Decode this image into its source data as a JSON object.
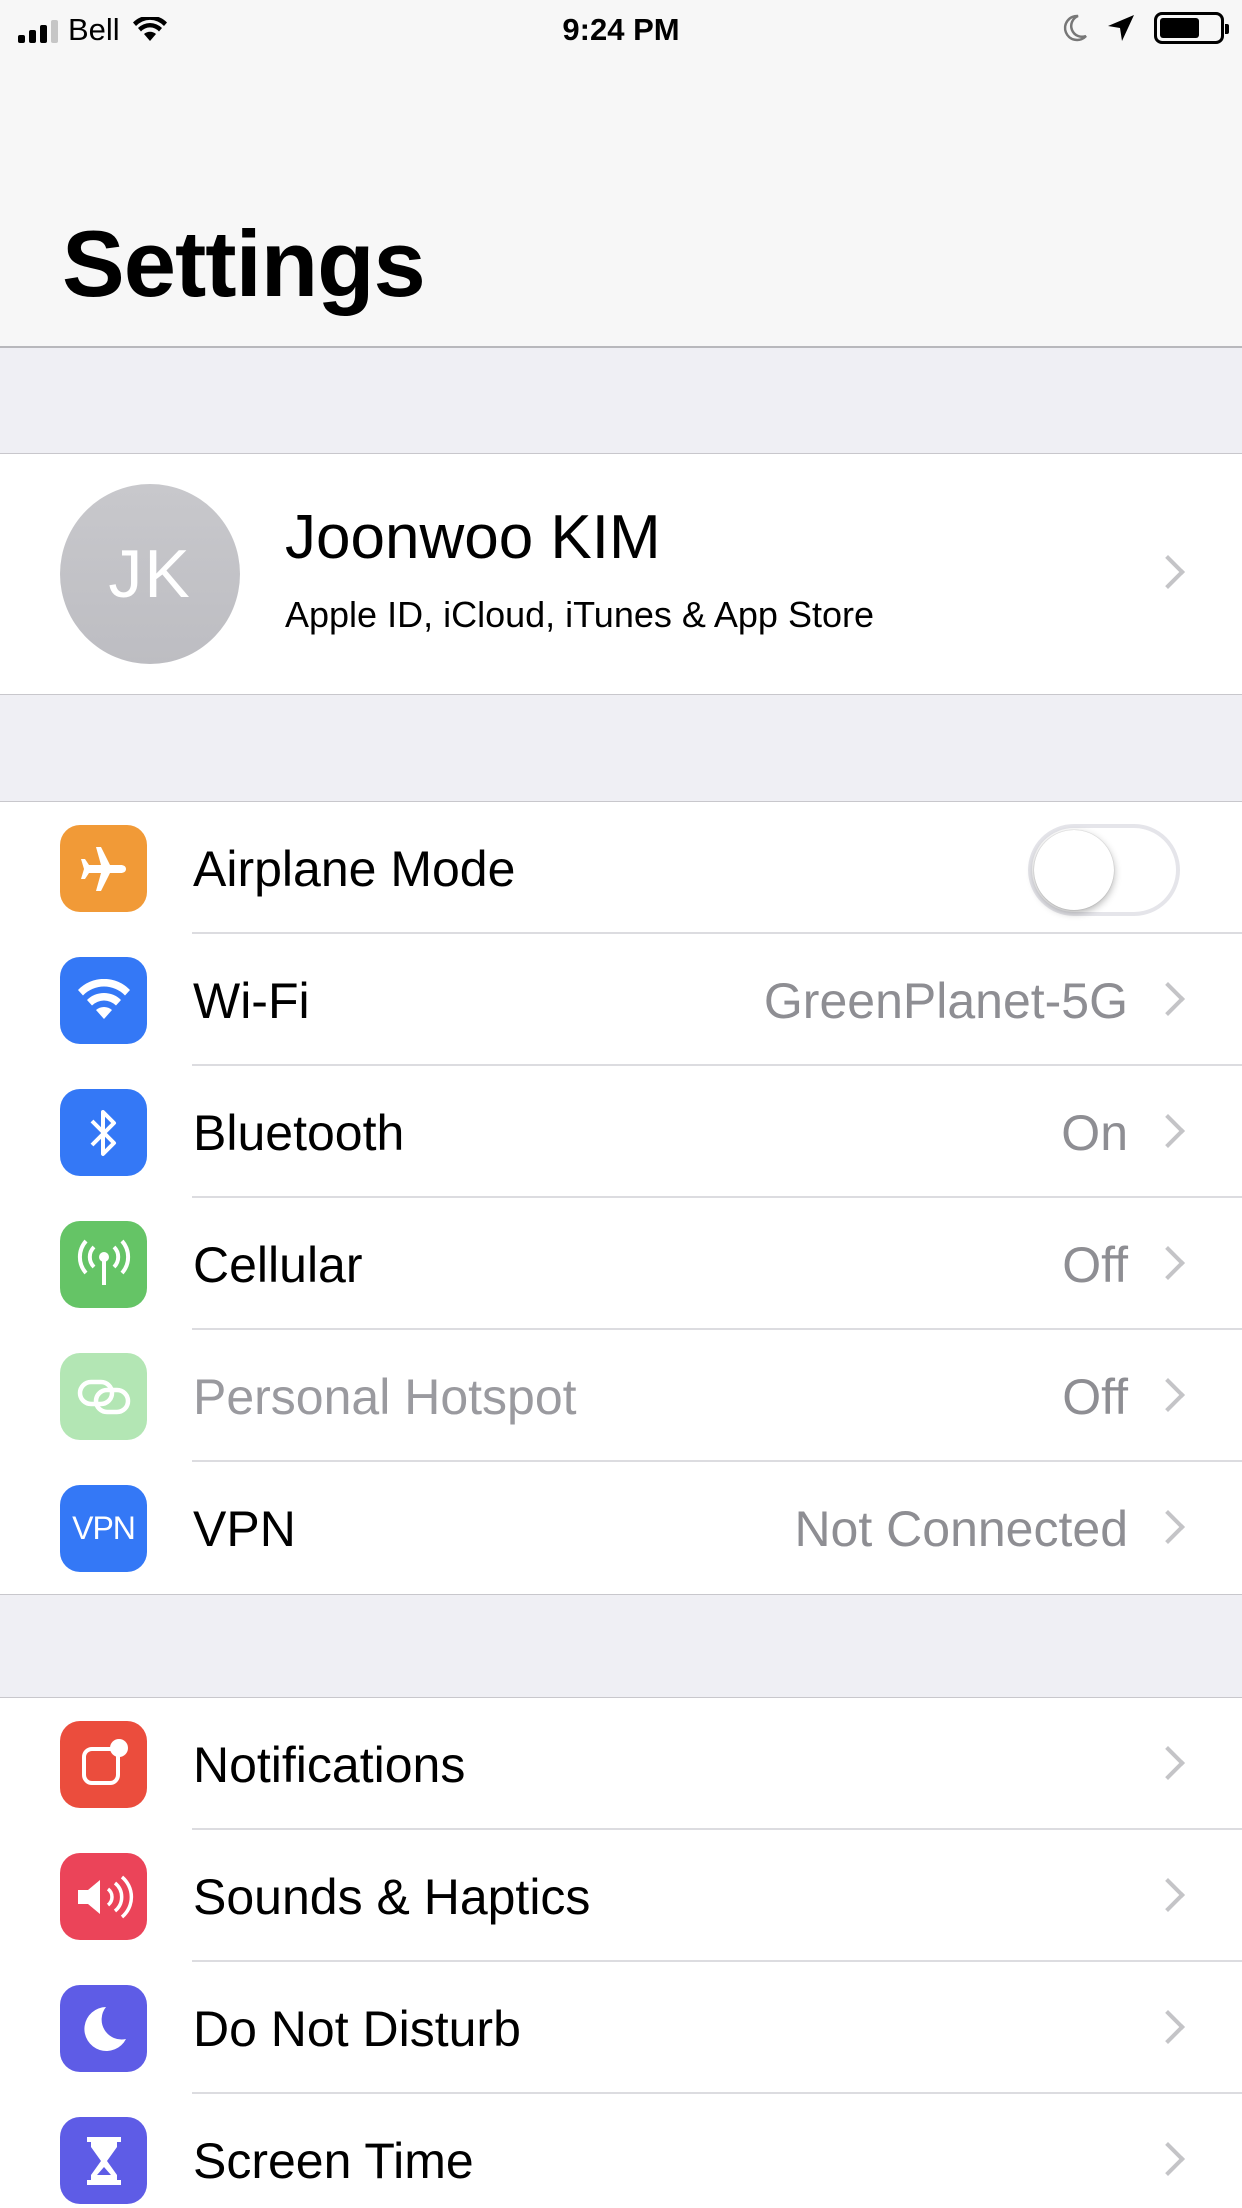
{
  "status_bar": {
    "carrier": "Bell",
    "time": "9:24 PM",
    "battery_level": 0.68
  },
  "header": {
    "title": "Settings"
  },
  "profile": {
    "initials": "JK",
    "name": "Joonwoo KIM",
    "subtitle": "Apple ID, iCloud, iTunes & App Store"
  },
  "connectivity": [
    {
      "label": "Airplane Mode",
      "icon": "airplane-icon",
      "color": "#f19a37",
      "toggle": false
    },
    {
      "label": "Wi-Fi",
      "icon": "wifi-icon",
      "color": "#3478f6",
      "value": "GreenPlanet-5G"
    },
    {
      "label": "Bluetooth",
      "icon": "bluetooth-icon",
      "color": "#3478f6",
      "value": "On"
    },
    {
      "label": "Cellular",
      "icon": "cellular-antenna-icon",
      "color": "#65c466",
      "value": "Off"
    },
    {
      "label": "Personal Hotspot",
      "icon": "hotspot-icon",
      "color": "#b3e6b4",
      "value": "Off",
      "disabled": true
    },
    {
      "label": "VPN",
      "icon": "vpn-icon",
      "icon_text": "VPN",
      "color": "#3478f6",
      "value": "Not Connected"
    }
  ],
  "system": [
    {
      "label": "Notifications",
      "icon": "notifications-icon",
      "color": "#eb4d3d"
    },
    {
      "label": "Sounds & Haptics",
      "icon": "speaker-icon",
      "color": "#eb4459"
    },
    {
      "label": "Do Not Disturb",
      "icon": "moon-icon",
      "color": "#5e5ce6"
    },
    {
      "label": "Screen Time",
      "icon": "hourglass-icon",
      "color": "#5e5ce6"
    }
  ]
}
